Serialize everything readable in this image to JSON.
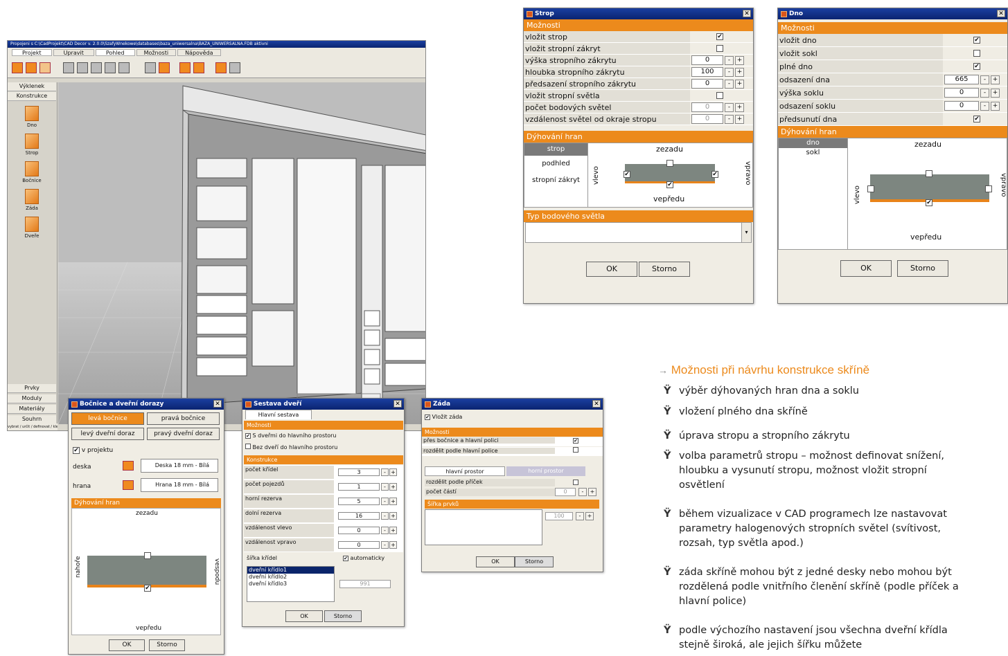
{
  "main_window": {
    "title": "Propojeni s C:\\CadProjekt\\CAD Decor v. 2.0.0\\SzafyWnekowe\\databases\\baza_uniwersalna\\BAZA_UNIWERSALNA.FDB aktivni",
    "menu": [
      "Projekt",
      "Upravit",
      "Pohled",
      "Možnosti",
      "Nápověda"
    ],
    "side_top": [
      "Výklenek",
      "Konstrukce"
    ],
    "side_icons": [
      "Dno",
      "Strop",
      "Bočnice",
      "Záda",
      "Dveře"
    ],
    "side_bottom": [
      "Prvky",
      "Moduly",
      "Materiály",
      "Souhrn"
    ],
    "status": "vybrat / určit / definovat / klepn"
  },
  "strop": {
    "title": "Strop",
    "header": "Možnosti",
    "rows": [
      {
        "label": "vložit strop",
        "type": "check",
        "checked": "✔"
      },
      {
        "label": "vložit stropní zákryt",
        "type": "check",
        "checked": ""
      },
      {
        "label": "výška stropního zákrytu",
        "type": "num",
        "value": "0"
      },
      {
        "label": "hloubka stropního zákrytu",
        "type": "num",
        "value": "100"
      },
      {
        "label": "předsazení stropního zákrytu",
        "type": "num",
        "value": "0"
      },
      {
        "label": "vložit stropní světla",
        "type": "check",
        "checked": ""
      },
      {
        "label": "počet bodových světel",
        "type": "numdis",
        "value": "0"
      },
      {
        "label": "vzdálenost světel od okraje stropu",
        "type": "numdis",
        "value": "0"
      }
    ],
    "edge_header": "Dýhování hran",
    "edge_list": [
      "strop",
      "podhled",
      "stropní zákryt"
    ],
    "back": "zezadu",
    "front": "vepředu",
    "left": "vlevo",
    "right": "vpravo",
    "light_header": "Typ bodového světla",
    "ok": "OK",
    "cancel": "Storno"
  },
  "dno": {
    "title": "Dno",
    "header": "Možnosti",
    "rows": [
      {
        "label": "vložit dno",
        "type": "check",
        "checked": "✔"
      },
      {
        "label": "vložit sokl",
        "type": "check",
        "checked": ""
      },
      {
        "label": "plné dno",
        "type": "check",
        "checked": "✔"
      },
      {
        "label": "odsazení dna",
        "type": "num",
        "value": "665"
      },
      {
        "label": "výška soklu",
        "type": "num",
        "value": "0"
      },
      {
        "label": "odsazení soklu",
        "type": "num",
        "value": "0"
      },
      {
        "label": "předsunutí dna",
        "type": "check",
        "checked": "✔"
      }
    ],
    "edge_header": "Dýhování hran",
    "edge_list": [
      "dno",
      "sokl"
    ],
    "back": "zezadu",
    "front": "vepředu",
    "left": "vlevo",
    "right": "vpravo",
    "ok": "OK",
    "cancel": "Storno"
  },
  "bocnice": {
    "title": "Bočnice a dveřní dorazy",
    "tabs": [
      "levá bočnice",
      "pravá bočnice",
      "levý dveřní doraz",
      "pravý dveřní doraz"
    ],
    "in_project": "v projektu",
    "deska_label": "deska",
    "deska_value": "Deska 18 mm - Bílá",
    "hrana_label": "hrana",
    "hrana_value": "Hrana 18 mm - Bílá",
    "edge_header": "Dýhování hran",
    "back": "zezadu",
    "front": "vepředu",
    "left": "nahoře",
    "right": "vespodu",
    "ok": "OK",
    "cancel": "Storno"
  },
  "sestava": {
    "title": "Sestava dveří",
    "tab": "Hlavní sestava",
    "header": "Možnosti",
    "opt1": "S dveřmi do hlavního prostoru",
    "opt2": "Bez dveří do hlavního prostoru",
    "konstr": "Konstrukce",
    "rows": [
      {
        "label": "počet křídel",
        "value": "3"
      },
      {
        "label": "počet pojezdů",
        "value": "1"
      },
      {
        "label": "horní rezerva",
        "value": "5"
      },
      {
        "label": "dolní rezerva",
        "value": "16"
      },
      {
        "label": "vzdálenost vlevo",
        "value": "0"
      },
      {
        "label": "vzdálenost vpravo",
        "value": "0"
      }
    ],
    "width_label": "šířka křídel",
    "auto": "automaticky",
    "doors": [
      "dveřní křídlo1",
      "dveřní křídlo2",
      "dveřní křídlo3"
    ],
    "width_value": "991",
    "ok": "OK",
    "cancel": "Storno"
  },
  "zada": {
    "title": "Záda",
    "insert": "Vložit záda",
    "header": "Možnosti",
    "opt1": "přes bočnice a hlavní polici",
    "opt2": "rozdělit podle hlavní police",
    "tab1": "hlavní prostor",
    "tab2": "horní prostor",
    "split": "rozdělit podle příček",
    "parts": "počet částí",
    "parts_value": "0",
    "width_header": "Šířka prvků",
    "width_value": "100",
    "ok": "OK",
    "cancel": "Storno"
  },
  "info": {
    "heading": "Možnosti při návrhu konstrukce skříně",
    "bullets": [
      "výběr dýhovaných hran dna a soklu",
      "vložení plného dna skříně",
      "úprava stropu a stropního zákrytu",
      "volba parametrů stropu – možnost definovat snížení, hloubku a vysunutí stropu, možnost vložit stropní osvětlení",
      "během vizualizace v CAD programech lze nastavovat parametry halogenových stropních světel (svítivost, rozsah, typ světla apod.)",
      "záda skříně mohou být z jedné desky nebo mohou být rozdělená podle vnitřního členění skříně (podle příček a hlavní police)",
      "podle výchozího nastavení jsou všechna dveřní křídla stejně široká, ale jejich šířku můžete"
    ],
    "bullet_mark": "Ÿ",
    "arrow": "→"
  }
}
